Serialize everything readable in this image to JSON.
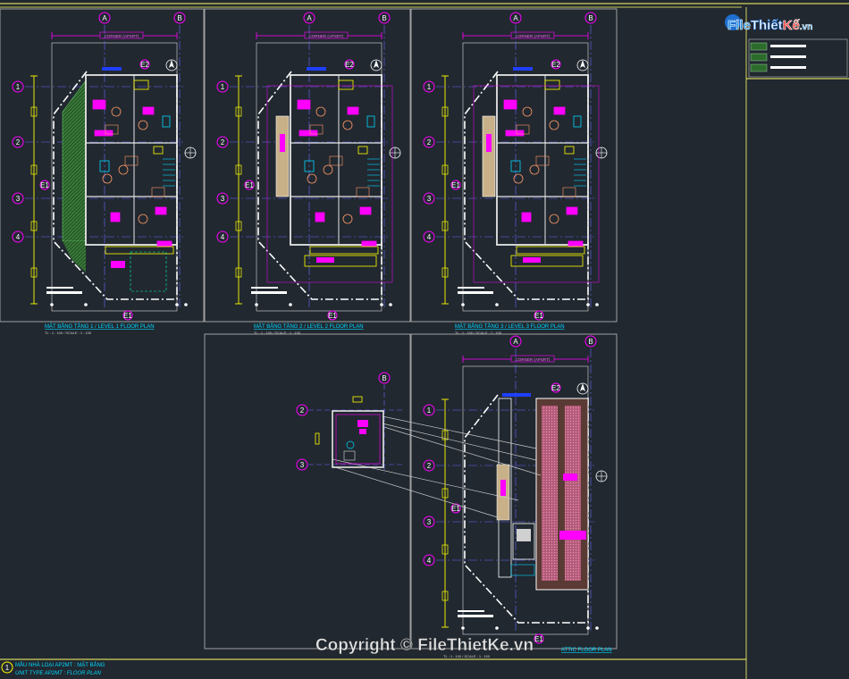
{
  "logo": {
    "part1": "File",
    "part2": "Thiết",
    "part3": "Kế",
    "part4": ".vn"
  },
  "grid_labels": {
    "cols": [
      "A",
      "B"
    ],
    "rows": [
      "1",
      "2",
      "3",
      "4"
    ],
    "side": "E1",
    "bottom": "E1",
    "top_small": "E2"
  },
  "dimension_tag": "CORNER (APSRT)",
  "plans": [
    {
      "title": "MẶT BẰNG TẦNG 1 / LEVEL 1 FLOOR PLAN",
      "scale": "TL : 1 : 100 / SCALE : 1 : 100"
    },
    {
      "title": "MẶT BẰNG TẦNG 2 / LEVEL 2 FLOOR PLAN",
      "scale": "TL : 1 : 100 / SCALE : 1 : 100"
    },
    {
      "title": "MẶT BẰNG TẦNG 3 / LEVEL 3 FLOOR PLAN",
      "scale": "TL : 1 : 100 / SCALE : 1 : 100"
    },
    {
      "title": "ATTIC FLOOR PLAN",
      "scale": "TL : 1 : 100 / SCALE : 1 : 100"
    }
  ],
  "sheet": {
    "number": "1",
    "title_vi": "MẪU NHÀ LOẠI AP2MT : MẶT BẰNG",
    "title_en": "UNIT TYPE AP2MT : FLOOR PLAN"
  },
  "watermark": "Copyright © FileThietKe.vn",
  "colors": {
    "background": "#212830",
    "magenta": "#ff00ff",
    "yellow": "#ffff00",
    "cyan": "#00d8ff",
    "green": "#3a8a3a"
  }
}
